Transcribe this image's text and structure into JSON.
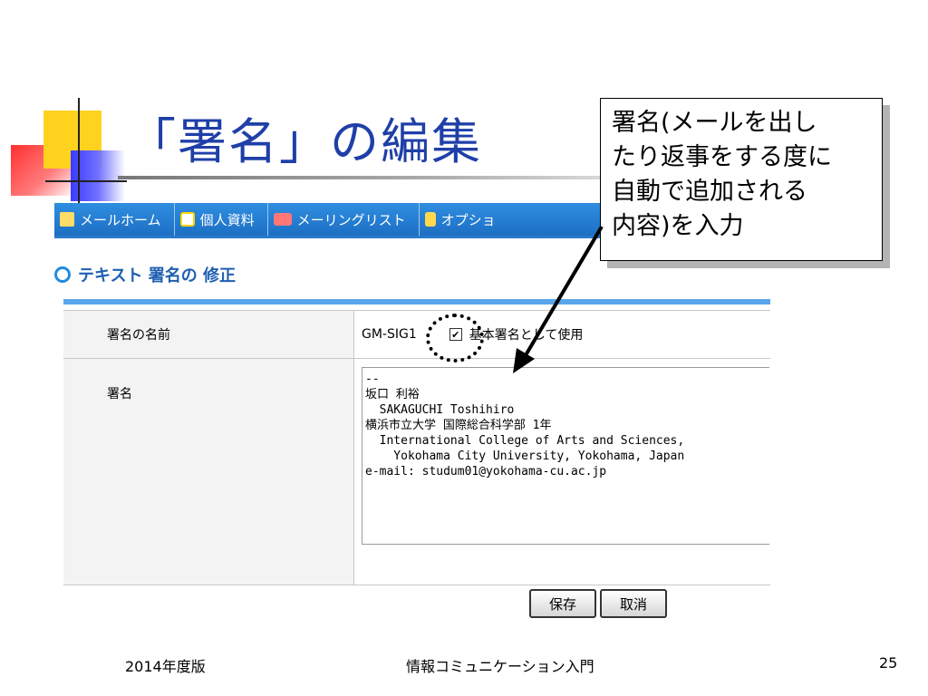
{
  "slide": {
    "title": "「署名」の編集",
    "callout_text": "署名(メールを出し\nたり返事をする度に\n自動で追加される\n内容)を入力"
  },
  "nav": {
    "items": [
      {
        "label": "メールホーム",
        "icon": "home-icon"
      },
      {
        "label": "個人資料",
        "icon": "profile-icon"
      },
      {
        "label": "メーリングリスト",
        "icon": "mailing-list-icon"
      },
      {
        "label": "オプショ",
        "icon": "option-icon"
      }
    ]
  },
  "section": {
    "title": "テキスト 署名の 修正"
  },
  "form": {
    "name_label": "署名の名前",
    "name_value": "GM-SIG1",
    "default_checkbox_label": "基本署名として使用",
    "default_checkbox_checked": true,
    "checkbox_mark": "✔",
    "signature_label": "署名",
    "signature_text": "--\n坂口 利裕\n  SAKAGUCHI Toshihiro\n横浜市立大学 国際総合科学部 1年\n  International College of Arts and Sciences,\n    Yokohama City University, Yokohama, Japan\ne-mail: studum01@yokohama-cu.ac.jp"
  },
  "buttons": {
    "save": "保存",
    "cancel": "取消"
  },
  "footer": {
    "left": "2014年度版",
    "center": "情報コミュニケーション入門",
    "page_number": "25"
  },
  "colors": {
    "title": "#1f3fa8",
    "nav_bar": "#1d6fc4",
    "section_title": "#1d5fb0",
    "table_accent": "#5aa6ea"
  }
}
